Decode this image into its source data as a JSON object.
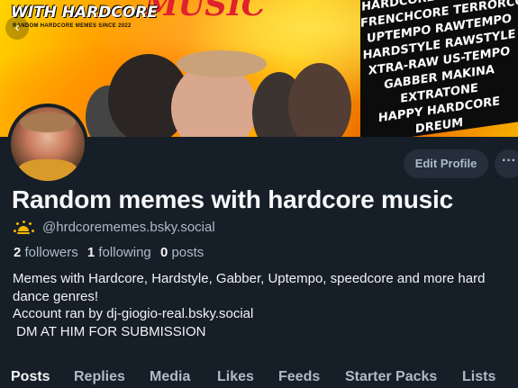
{
  "banner": {
    "title": "WITH HARDCORE",
    "subtitle": "RANDOM HARDCORE MEMES SINCE 2022",
    "music_word": "MUSIC",
    "genres": [
      "HARDCORE SPEEDCORE",
      "FRENCHCORE TERRORCORE",
      "UPTEMPO RAWTEMPO",
      "HARDSTYLE RAWSTYLE",
      "XTRA-RAW US-TEMPO",
      "GABBER MAKINA",
      "EXTRATONE",
      "HAPPY HARDCORE",
      "DREUM"
    ]
  },
  "profile": {
    "display_name": "Random memes with hardcore music",
    "handle": "@hrdcorememes.bsky.social",
    "handle_icon": "sun-icon",
    "followers_count": "2",
    "followers_label": "followers",
    "following_count": "1",
    "following_label": "following",
    "posts_count": "0",
    "posts_label": "posts",
    "bio": [
      "Memes with Hardcore, Hardstyle, Gabber, Uptempo, speedcore and more hard",
      "dance genres!",
      "Account ran by dj-giogio-real.bsky.social",
      " DM AT HIM FOR SUBMISSION"
    ]
  },
  "buttons": {
    "edit_profile": "Edit Profile",
    "more": "···"
  },
  "tabs": [
    "Posts",
    "Replies",
    "Media",
    "Likes",
    "Feeds",
    "Starter Packs",
    "Lists"
  ],
  "active_tab": "Posts",
  "colors": {
    "background": "#161e27",
    "muted_text": "#aebbc9",
    "button_bg": "#252f3b"
  }
}
